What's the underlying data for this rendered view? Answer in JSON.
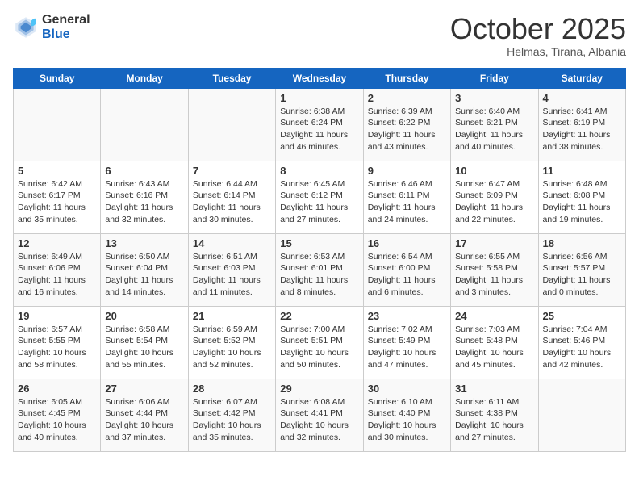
{
  "header": {
    "logo_general": "General",
    "logo_blue": "Blue",
    "month_title": "October 2025",
    "subtitle": "Helmas, Tirana, Albania"
  },
  "days_of_week": [
    "Sunday",
    "Monday",
    "Tuesday",
    "Wednesday",
    "Thursday",
    "Friday",
    "Saturday"
  ],
  "weeks": [
    [
      {
        "day": "",
        "info": ""
      },
      {
        "day": "",
        "info": ""
      },
      {
        "day": "",
        "info": ""
      },
      {
        "day": "1",
        "info": "Sunrise: 6:38 AM\nSunset: 6:24 PM\nDaylight: 11 hours\nand 46 minutes."
      },
      {
        "day": "2",
        "info": "Sunrise: 6:39 AM\nSunset: 6:22 PM\nDaylight: 11 hours\nand 43 minutes."
      },
      {
        "day": "3",
        "info": "Sunrise: 6:40 AM\nSunset: 6:21 PM\nDaylight: 11 hours\nand 40 minutes."
      },
      {
        "day": "4",
        "info": "Sunrise: 6:41 AM\nSunset: 6:19 PM\nDaylight: 11 hours\nand 38 minutes."
      }
    ],
    [
      {
        "day": "5",
        "info": "Sunrise: 6:42 AM\nSunset: 6:17 PM\nDaylight: 11 hours\nand 35 minutes."
      },
      {
        "day": "6",
        "info": "Sunrise: 6:43 AM\nSunset: 6:16 PM\nDaylight: 11 hours\nand 32 minutes."
      },
      {
        "day": "7",
        "info": "Sunrise: 6:44 AM\nSunset: 6:14 PM\nDaylight: 11 hours\nand 30 minutes."
      },
      {
        "day": "8",
        "info": "Sunrise: 6:45 AM\nSunset: 6:12 PM\nDaylight: 11 hours\nand 27 minutes."
      },
      {
        "day": "9",
        "info": "Sunrise: 6:46 AM\nSunset: 6:11 PM\nDaylight: 11 hours\nand 24 minutes."
      },
      {
        "day": "10",
        "info": "Sunrise: 6:47 AM\nSunset: 6:09 PM\nDaylight: 11 hours\nand 22 minutes."
      },
      {
        "day": "11",
        "info": "Sunrise: 6:48 AM\nSunset: 6:08 PM\nDaylight: 11 hours\nand 19 minutes."
      }
    ],
    [
      {
        "day": "12",
        "info": "Sunrise: 6:49 AM\nSunset: 6:06 PM\nDaylight: 11 hours\nand 16 minutes."
      },
      {
        "day": "13",
        "info": "Sunrise: 6:50 AM\nSunset: 6:04 PM\nDaylight: 11 hours\nand 14 minutes."
      },
      {
        "day": "14",
        "info": "Sunrise: 6:51 AM\nSunset: 6:03 PM\nDaylight: 11 hours\nand 11 minutes."
      },
      {
        "day": "15",
        "info": "Sunrise: 6:53 AM\nSunset: 6:01 PM\nDaylight: 11 hours\nand 8 minutes."
      },
      {
        "day": "16",
        "info": "Sunrise: 6:54 AM\nSunset: 6:00 PM\nDaylight: 11 hours\nand 6 minutes."
      },
      {
        "day": "17",
        "info": "Sunrise: 6:55 AM\nSunset: 5:58 PM\nDaylight: 11 hours\nand 3 minutes."
      },
      {
        "day": "18",
        "info": "Sunrise: 6:56 AM\nSunset: 5:57 PM\nDaylight: 11 hours\nand 0 minutes."
      }
    ],
    [
      {
        "day": "19",
        "info": "Sunrise: 6:57 AM\nSunset: 5:55 PM\nDaylight: 10 hours\nand 58 minutes."
      },
      {
        "day": "20",
        "info": "Sunrise: 6:58 AM\nSunset: 5:54 PM\nDaylight: 10 hours\nand 55 minutes."
      },
      {
        "day": "21",
        "info": "Sunrise: 6:59 AM\nSunset: 5:52 PM\nDaylight: 10 hours\nand 52 minutes."
      },
      {
        "day": "22",
        "info": "Sunrise: 7:00 AM\nSunset: 5:51 PM\nDaylight: 10 hours\nand 50 minutes."
      },
      {
        "day": "23",
        "info": "Sunrise: 7:02 AM\nSunset: 5:49 PM\nDaylight: 10 hours\nand 47 minutes."
      },
      {
        "day": "24",
        "info": "Sunrise: 7:03 AM\nSunset: 5:48 PM\nDaylight: 10 hours\nand 45 minutes."
      },
      {
        "day": "25",
        "info": "Sunrise: 7:04 AM\nSunset: 5:46 PM\nDaylight: 10 hours\nand 42 minutes."
      }
    ],
    [
      {
        "day": "26",
        "info": "Sunrise: 6:05 AM\nSunset: 4:45 PM\nDaylight: 10 hours\nand 40 minutes."
      },
      {
        "day": "27",
        "info": "Sunrise: 6:06 AM\nSunset: 4:44 PM\nDaylight: 10 hours\nand 37 minutes."
      },
      {
        "day": "28",
        "info": "Sunrise: 6:07 AM\nSunset: 4:42 PM\nDaylight: 10 hours\nand 35 minutes."
      },
      {
        "day": "29",
        "info": "Sunrise: 6:08 AM\nSunset: 4:41 PM\nDaylight: 10 hours\nand 32 minutes."
      },
      {
        "day": "30",
        "info": "Sunrise: 6:10 AM\nSunset: 4:40 PM\nDaylight: 10 hours\nand 30 minutes."
      },
      {
        "day": "31",
        "info": "Sunrise: 6:11 AM\nSunset: 4:38 PM\nDaylight: 10 hours\nand 27 minutes."
      },
      {
        "day": "",
        "info": ""
      }
    ]
  ]
}
